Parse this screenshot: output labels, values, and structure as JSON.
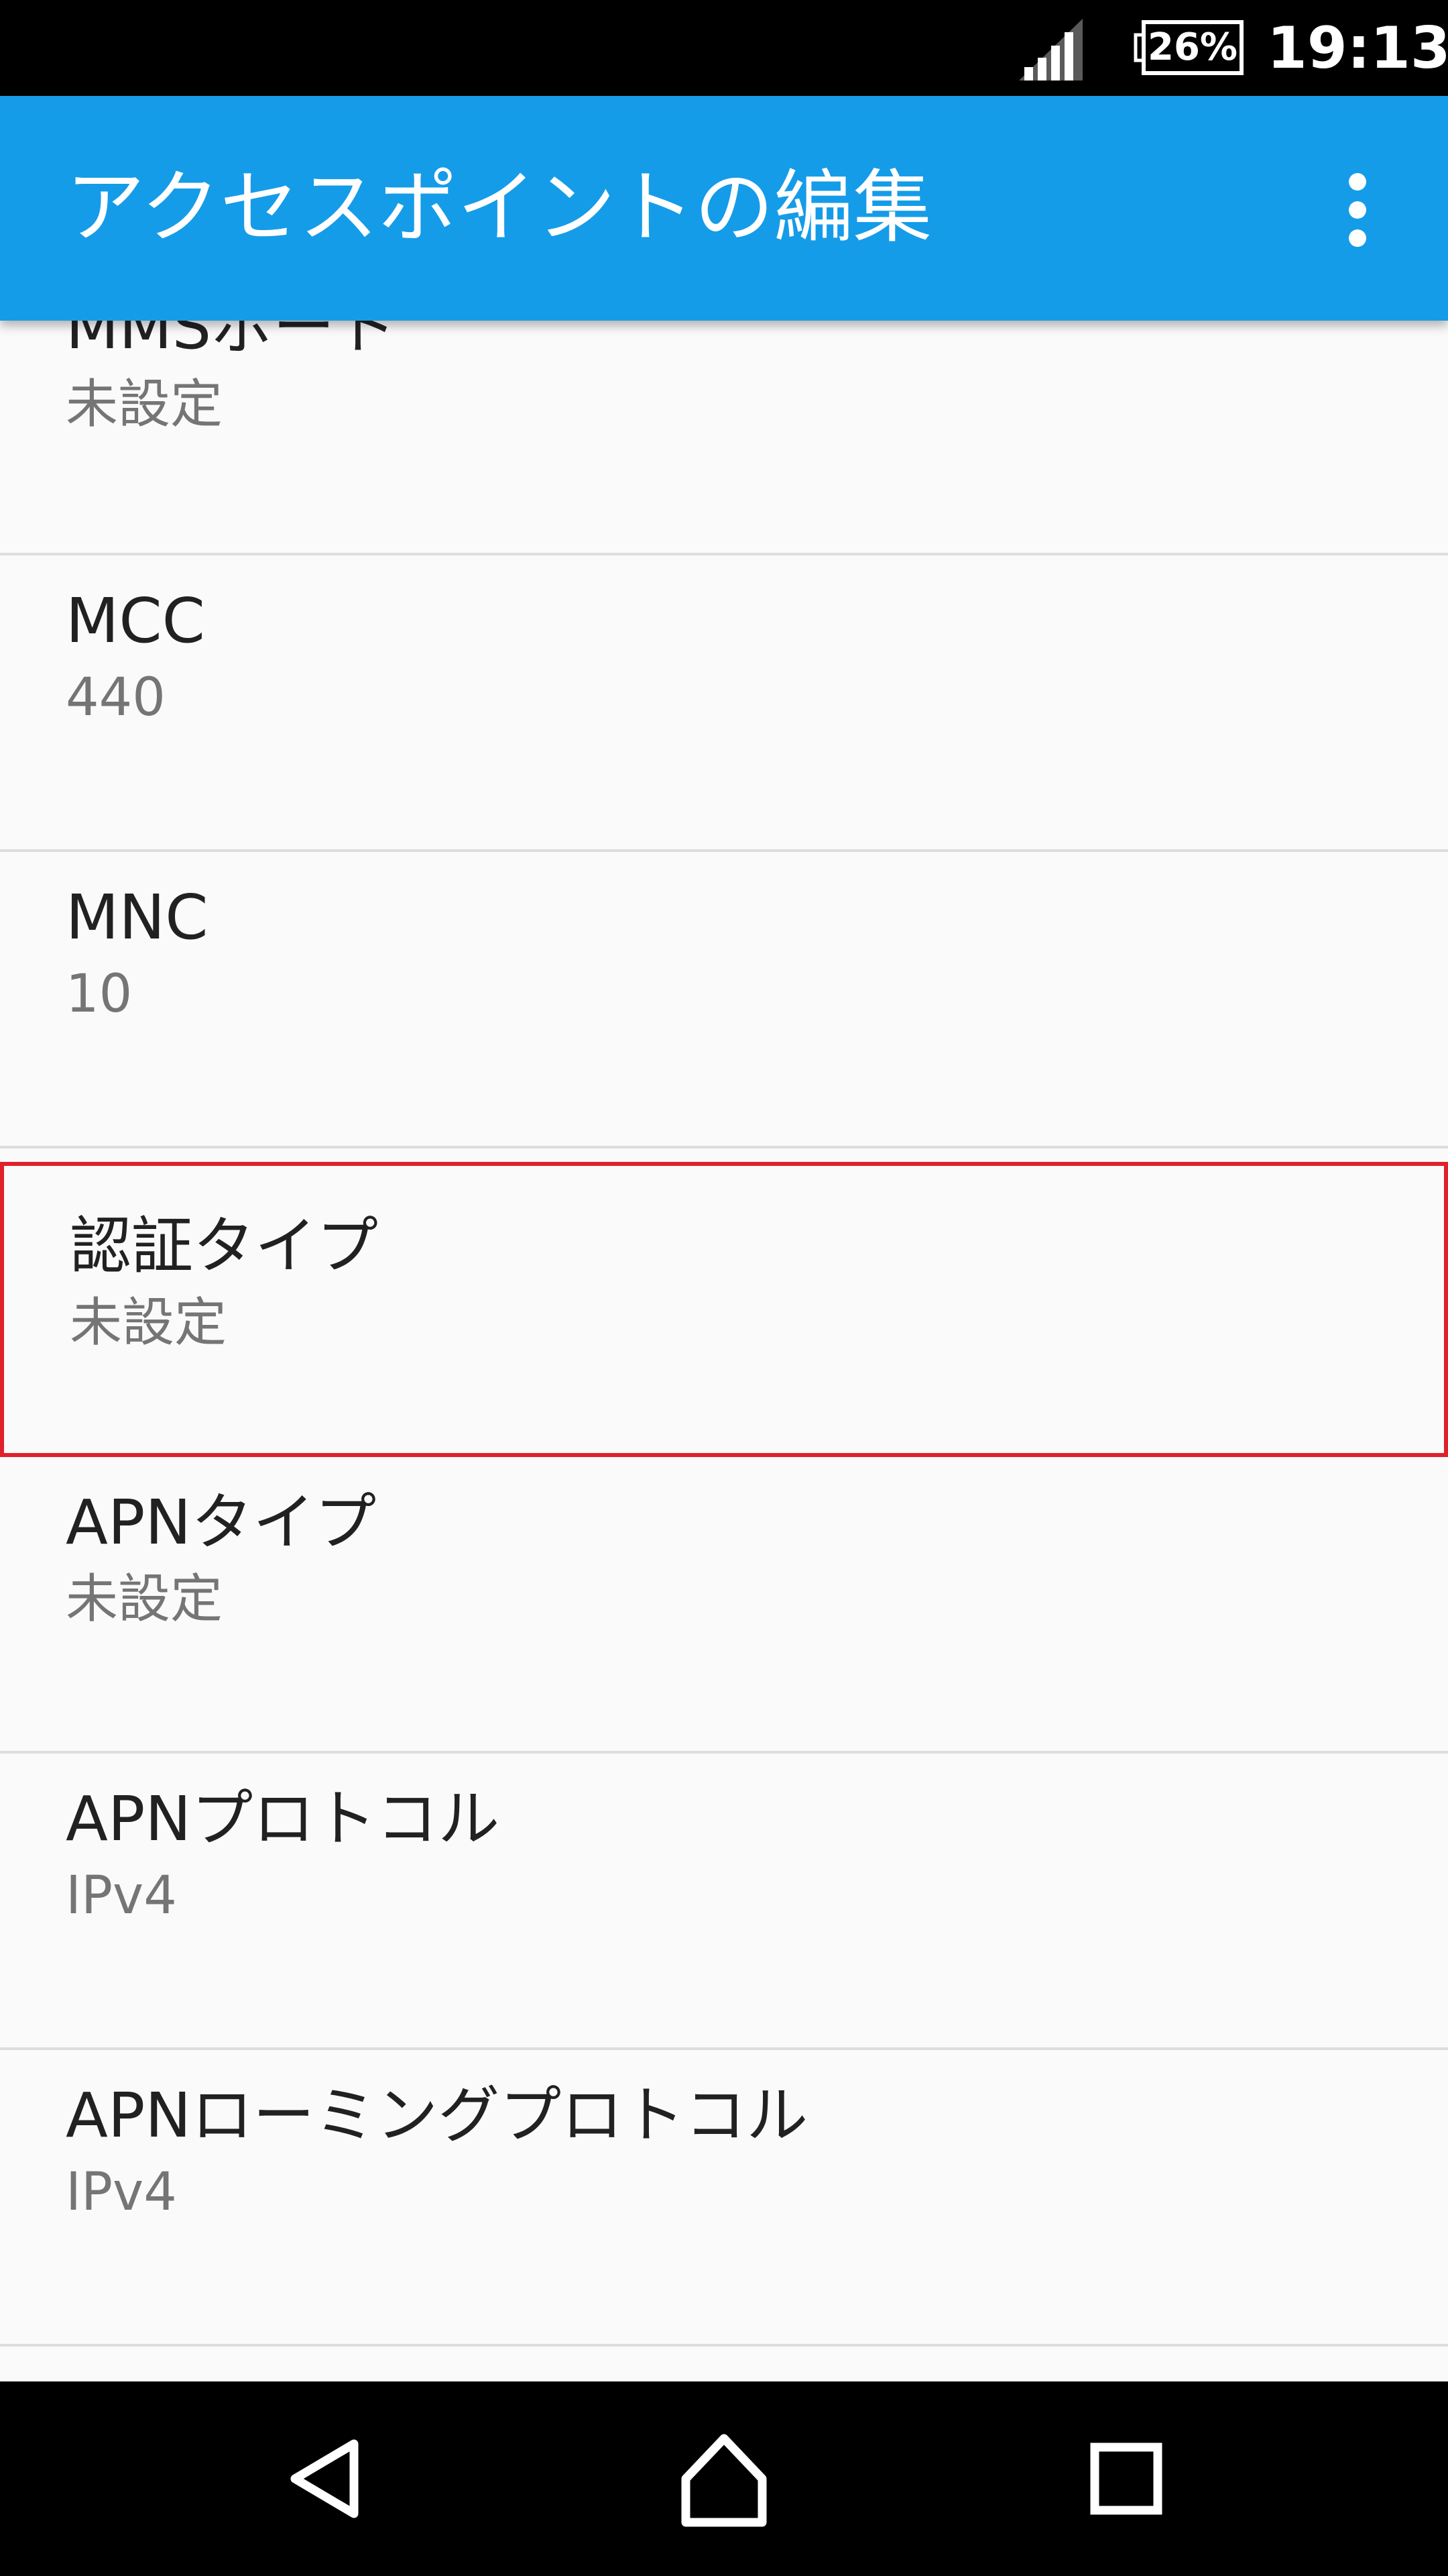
{
  "status_bar": {
    "signal_icon": "signal-icon",
    "battery_icon": "battery-icon",
    "battery_level": "26%",
    "time": "19:13"
  },
  "app_bar": {
    "title": "アクセスポイントの編集",
    "overflow_icon": "more-vert-icon"
  },
  "settings": [
    {
      "label": "MMSポート",
      "value": "未設定"
    },
    {
      "label": "MCC",
      "value": "440"
    },
    {
      "label": "MNC",
      "value": "10"
    },
    {
      "label": "認証タイプ",
      "value": "未設定"
    },
    {
      "label": "APNタイプ",
      "value": "未設定"
    },
    {
      "label": "APNプロトコル",
      "value": "IPv4"
    },
    {
      "label": "APNローミングプロトコル",
      "value": "IPv4"
    }
  ],
  "highlight": {
    "selected_label": "認証タイプ",
    "color": "#e0202a"
  },
  "colors": {
    "app_bar": "#159ce8",
    "status_bar": "#000000",
    "nav_bar": "#000000",
    "background": "#fafafa",
    "primary_text": "#212121",
    "secondary_text": "#757575"
  },
  "nav_bar": {
    "back_icon": "back-icon",
    "home_icon": "home-icon",
    "recents_icon": "recents-icon"
  }
}
